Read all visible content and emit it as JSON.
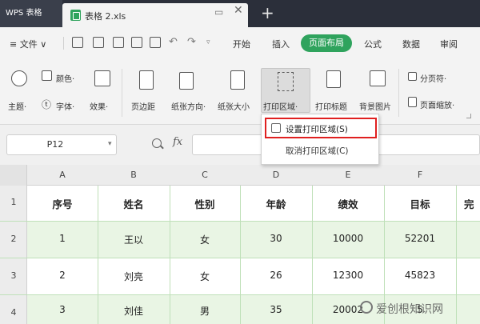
{
  "app": {
    "name": "WPS 表格",
    "doc_title": "表格 2.xls"
  },
  "menubar": {
    "file_label": "≡ 文件 ∨",
    "items": [
      "开始",
      "插入",
      "页面布局",
      "公式",
      "数据",
      "审阅"
    ],
    "active_item": "页面布局"
  },
  "ribbon": {
    "theme": "主题·",
    "colors": "颜色·",
    "fonts": "字体·",
    "effects": "效果·",
    "margins": "页边距",
    "orientation": "纸张方向·",
    "size": "纸张大小",
    "print_area": "打印区域·",
    "print_titles": "打印标题",
    "background": "背景图片",
    "page_break": "分页符·",
    "page_zoom": "页面缩放·"
  },
  "dropdown": {
    "set_print_area": "设置打印区域(S)",
    "cancel_print_area": "取消打印区域(C)"
  },
  "formula_bar": {
    "cell_ref": "P12",
    "fx_label": "fx",
    "content": ""
  },
  "grid": {
    "columns": [
      "A",
      "B",
      "C",
      "D",
      "E",
      "F"
    ],
    "rows": [
      "1",
      "2",
      "3",
      "4"
    ],
    "header": [
      "序号",
      "姓名",
      "性别",
      "年龄",
      "绩效",
      "目标",
      "完"
    ],
    "data": [
      [
        "1",
        "王以",
        "女",
        "30",
        "10000",
        "52201"
      ],
      [
        "2",
        "刘亮",
        "女",
        "26",
        "12300",
        "45823"
      ],
      [
        "3",
        "刘佳",
        "男",
        "35",
        "20002",
        "5"
      ]
    ]
  },
  "colors": {
    "accent_green": "#2fa35d",
    "highlight_red": "#e02020",
    "row_band": "#e9f5e4"
  },
  "watermark": "爱创根知识网"
}
